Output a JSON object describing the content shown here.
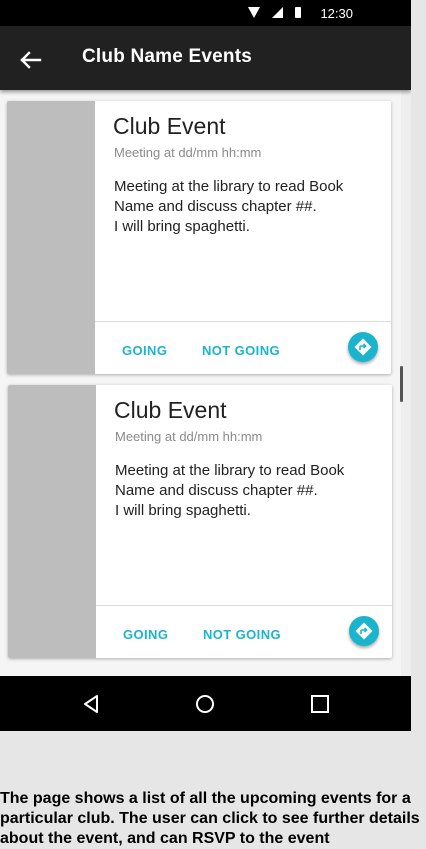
{
  "status_bar": {
    "time": "12:30"
  },
  "app_bar": {
    "title": "Club Name Events"
  },
  "events": [
    {
      "title": "Club Event",
      "meta": "Meeting at dd/mm hh:mm",
      "description": "Meeting at the library to read Book Name and discuss chapter ##.\nI will bring spaghetti.",
      "going_label": "GOING",
      "not_going_label": "NOT GOING"
    },
    {
      "title": "Club Event",
      "meta": "Meeting at dd/mm hh:mm",
      "description": "Meeting at the library to read Book Name and discuss chapter ##.\nI will bring spaghetti.",
      "going_label": "GOING",
      "not_going_label": "NOT GOING"
    }
  ],
  "caption": "The page shows a list of all the upcoming events for a particular club. The user can click to see further details about the event, and can RSVP to the event",
  "colors": {
    "accent": "#1ab5cc",
    "app_bar": "#212121",
    "placeholder_image": "#bdbdbd"
  },
  "icons": {
    "back": "arrow-left-icon",
    "directions": "directions-icon",
    "nav_back": "triangle-back-icon",
    "nav_home": "circle-home-icon",
    "nav_recents": "square-recents-icon"
  }
}
